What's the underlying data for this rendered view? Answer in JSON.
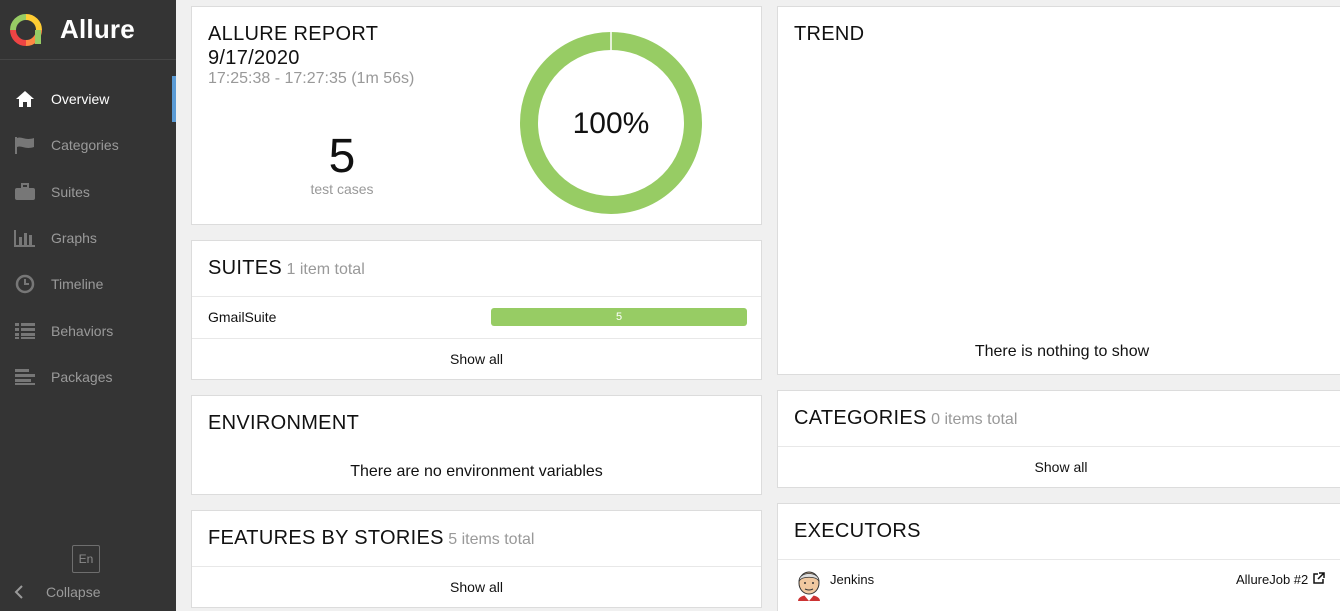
{
  "sidebar": {
    "brand": "Allure",
    "items": [
      {
        "label": "Overview",
        "icon": "home-icon"
      },
      {
        "label": "Categories",
        "icon": "flag-icon"
      },
      {
        "label": "Suites",
        "icon": "briefcase-icon"
      },
      {
        "label": "Graphs",
        "icon": "bar-chart-icon"
      },
      {
        "label": "Timeline",
        "icon": "clock-icon"
      },
      {
        "label": "Behaviors",
        "icon": "list-icon"
      },
      {
        "label": "Packages",
        "icon": "align-left-icon"
      }
    ],
    "active_item": "Overview",
    "language": "En",
    "collapse_label": "Collapse"
  },
  "summary": {
    "title": "ALLURE REPORT",
    "date": "9/17/2020",
    "time_range": "17:25:38 - 17:27:35 (1m 56s)",
    "test_count": "5",
    "test_count_label": "test cases",
    "pass_rate": "100%",
    "pass_fraction": 1.0
  },
  "suites": {
    "title": "SUITES",
    "subtitle": "1 item total",
    "rows": [
      {
        "name": "GmailSuite",
        "count": "5",
        "fraction": 1.0
      }
    ],
    "show_all": "Show all"
  },
  "environment": {
    "title": "ENVIRONMENT",
    "message": "There are no environment variables"
  },
  "features": {
    "title": "FEATURES BY STORIES",
    "subtitle": "5 items total",
    "show_all": "Show all"
  },
  "trend": {
    "title": "TREND",
    "message": "There is nothing to show"
  },
  "categories": {
    "title": "CATEGORIES",
    "subtitle": "0 items total",
    "show_all": "Show all"
  },
  "executors": {
    "title": "EXECUTORS",
    "name": "Jenkins",
    "job": "AllureJob #2"
  },
  "colors": {
    "sidebar_bg": "#343434",
    "passed_green": "#97cc64",
    "active_accent": "#5b9bd5"
  }
}
